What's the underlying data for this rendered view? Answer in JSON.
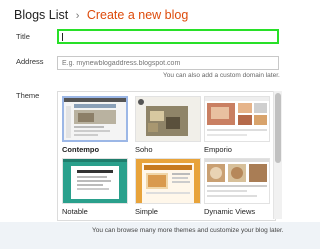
{
  "breadcrumb": {
    "parent": "Blogs List",
    "separator": "›",
    "current": "Create a new blog"
  },
  "form": {
    "title_label": "Title",
    "title_value": "",
    "address_label": "Address",
    "address_placeholder": "E.g. mynewblogaddress.blogspot.com",
    "address_hint": "You can also add a custom domain later.",
    "theme_label": "Theme"
  },
  "themes": [
    {
      "name": "Contempo",
      "selected": true,
      "icon": "theme-thumbnail"
    },
    {
      "name": "Soho",
      "selected": false,
      "icon": "theme-thumbnail"
    },
    {
      "name": "Emporio",
      "selected": false,
      "icon": "theme-thumbnail"
    },
    {
      "name": "Notable",
      "selected": false,
      "icon": "theme-thumbnail"
    },
    {
      "name": "Simple",
      "selected": false,
      "icon": "theme-thumbnail"
    },
    {
      "name": "Dynamic Views",
      "selected": false,
      "icon": "theme-thumbnail"
    }
  ],
  "footer_note": "You can browse many more themes and customize your blog later.",
  "colors": {
    "accent": "#dd4b0b",
    "focus_border": "#28e028",
    "selected_border": "#9cb7e6",
    "notable_green": "#2aa08c",
    "simple_orange": "#e8a33a"
  }
}
